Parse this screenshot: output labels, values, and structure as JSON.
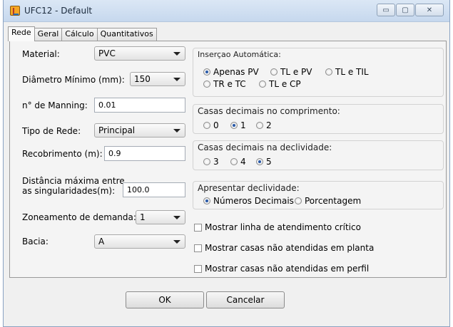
{
  "window": {
    "title": "UFC12 - Default",
    "icon": "java-app-icon"
  },
  "window_controls": {
    "minimize": "▭",
    "maximize": "▢",
    "close": "✕"
  },
  "tabs": [
    {
      "label": "Rede",
      "active": true
    },
    {
      "label": "Geral",
      "active": false
    },
    {
      "label": "Cálculo",
      "active": false
    },
    {
      "label": "Quantitativos",
      "active": false
    }
  ],
  "left": {
    "material": {
      "label": "Material:",
      "value": "PVC"
    },
    "diametro": {
      "label": "Diâmetro Mínimo (mm):",
      "value": "150"
    },
    "manning": {
      "label": "n° de Manning:",
      "value": "0.01"
    },
    "tipo_rede": {
      "label": "Tipo de Rede:",
      "value": "Principal"
    },
    "recobrimento": {
      "label": "Recobrimento (m):",
      "value": "0.9"
    },
    "distancia": {
      "label_line1": "Distância máxima entre",
      "label_line2": "as singularidades(m):",
      "value": "100.0"
    },
    "zoneamento": {
      "label": "Zoneamento de demanda:",
      "value": "1"
    },
    "bacia": {
      "label": "Bacia:",
      "value": "A"
    }
  },
  "insercao": {
    "title": "Inserçao Automática:",
    "options": [
      {
        "label": "Apenas PV",
        "selected": true
      },
      {
        "label": "TL e PV",
        "selected": false
      },
      {
        "label": "TL e TIL",
        "selected": false
      },
      {
        "label": "TR e TC",
        "selected": false
      },
      {
        "label": "TL e CP",
        "selected": false
      }
    ]
  },
  "casas_comprimento": {
    "title": "Casas decimais no comprimento:",
    "options": [
      {
        "label": "0",
        "selected": false
      },
      {
        "label": "1",
        "selected": true
      },
      {
        "label": "2",
        "selected": false
      }
    ]
  },
  "casas_declividade": {
    "title": "Casas decimais na declividade:",
    "options": [
      {
        "label": "3",
        "selected": false
      },
      {
        "label": "4",
        "selected": false
      },
      {
        "label": "5",
        "selected": true
      }
    ]
  },
  "apresentar": {
    "title": "Apresentar declividade:",
    "options": [
      {
        "label": "Números Decimais",
        "selected": true
      },
      {
        "label": "Porcentagem",
        "selected": false
      }
    ]
  },
  "checkboxes": [
    {
      "label": "Mostrar linha de atendimento crítico",
      "checked": false
    },
    {
      "label": "Mostrar casas não atendidas em planta",
      "checked": false
    },
    {
      "label": "Mostrar casas não atendidas em perfil",
      "checked": false
    }
  ],
  "buttons": {
    "ok": "OK",
    "cancel": "Cancelar"
  },
  "colors": {
    "radio_dot": "#2758a8",
    "titlebar": "#c6d8ee"
  }
}
